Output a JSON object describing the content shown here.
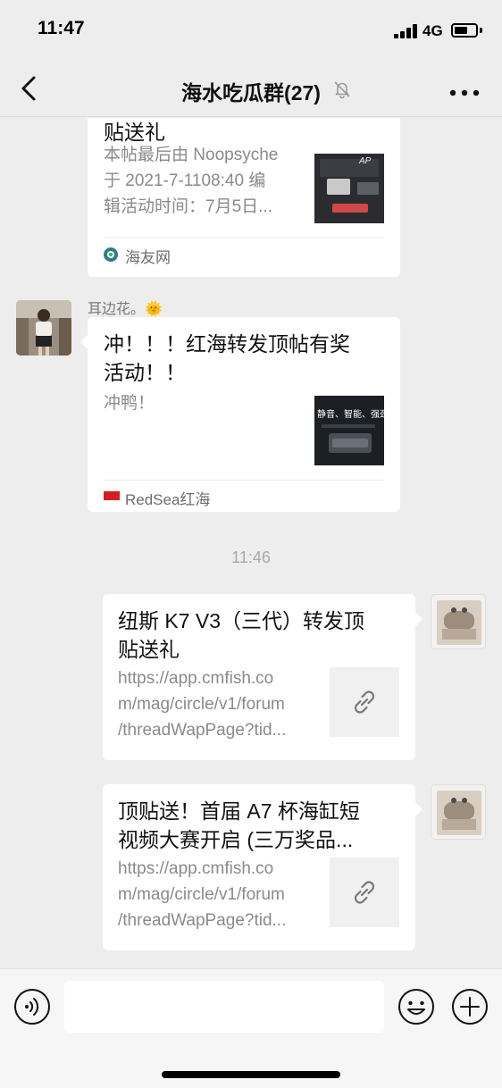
{
  "status_bar": {
    "time": "11:47",
    "network": "4G"
  },
  "header": {
    "title": "海水吃瓜群(27)"
  },
  "messages": {
    "m1": {
      "title": "贴送礼",
      "desc_lines": [
        "本帖最后由 Noopsyche",
        "于 2021-7-1108:40 编",
        "辑活动时间：7月5日..."
      ],
      "source": "海友网",
      "thumb_text": "AP"
    },
    "m2": {
      "sender": "耳边花。🌞",
      "title_lines": [
        "冲！！！红海转发顶帖有奖",
        "活动！！"
      ],
      "desc": "冲鸭！",
      "source": "RedSea红海",
      "thumb_text": "静音、智能、强劲"
    },
    "timestamp": "11:46",
    "m3": {
      "title_lines": [
        "纽斯 K7 V3（三代）转发顶",
        "贴送礼"
      ],
      "desc_lines": [
        "https://app.cmfish.co",
        "m/mag/circle/v1/forum",
        "/threadWapPage?tid..."
      ]
    },
    "m4": {
      "title_lines": [
        "顶贴送！首届 A7 杯海缸短",
        "视频大赛开启 (三万奖品..."
      ],
      "desc_lines": [
        "https://app.cmfish.co",
        "m/mag/circle/v1/forum",
        "/threadWapPage?tid..."
      ]
    }
  },
  "input": {
    "placeholder": ""
  },
  "icons": {
    "back": "chevron-left-icon",
    "mute": "bell-off-icon",
    "more": "more-dots-icon",
    "voice": "voice-icon",
    "emoji": "emoji-icon",
    "plus": "plus-icon",
    "link": "link-icon"
  },
  "colors": {
    "background": "#ededed",
    "bubble": "#ffffff",
    "secondary_text": "#8a8a8a"
  }
}
